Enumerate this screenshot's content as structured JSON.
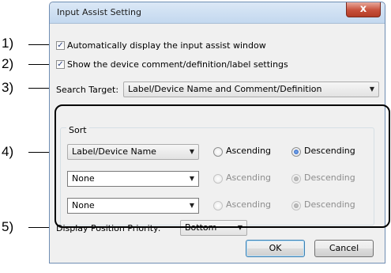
{
  "dialog": {
    "title": "Input Assist Setting",
    "close_glyph": "x"
  },
  "callouts": [
    "1)",
    "2)",
    "3)",
    "4)",
    "5)"
  ],
  "options": {
    "auto_display": {
      "label": "Automatically display the input assist window",
      "checked": true
    },
    "show_settings": {
      "label": "Show the device comment/definition/label settings",
      "checked": true
    }
  },
  "search_target": {
    "label": "Search Target:",
    "value": "Label/Device Name and Comment/Definition"
  },
  "sort": {
    "title": "Sort",
    "rows": [
      {
        "value": "Label/Device Name",
        "ascending": "Ascending",
        "descending": "Descending",
        "selected": "Descending",
        "enabled": true
      },
      {
        "value": "None",
        "ascending": "Ascending",
        "descending": "Descending",
        "selected": "Descending",
        "enabled": false
      },
      {
        "value": "None",
        "ascending": "Ascending",
        "descending": "Descending",
        "selected": "Descending",
        "enabled": false
      }
    ]
  },
  "display_position": {
    "label": "Display Position Priority:",
    "value": "Bottom"
  },
  "buttons": {
    "ok": "OK",
    "cancel": "Cancel"
  },
  "icons": {
    "checkbox_check": "✓",
    "dropdown_arrow": "▼"
  }
}
